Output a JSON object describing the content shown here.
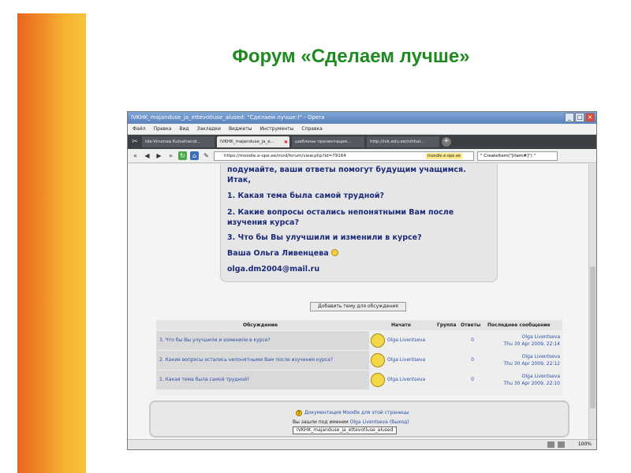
{
  "slide": {
    "title": "Форум «Сделаем лучше»"
  },
  "browser": {
    "window_title": "IVKHK_majanduse_ja_ettevotluse_alused: \"Сделаем лучше:)\" - Opera",
    "menu": [
      "Файл",
      "Правка",
      "Вид",
      "Закладки",
      "Виджеты",
      "Инструменты",
      "Справка"
    ],
    "tabs": [
      {
        "label": "Ida-Virumaa Kutsehanid..."
      },
      {
        "label": "IVKHK_majanduse_ja_e..."
      },
      {
        "label": "шаблоны презентация..."
      },
      {
        "label": "http://ivk.edu.ee/nihhai..."
      }
    ],
    "url": "https://moodle.e-ope.ee/mod/forum/view.php?id=79164",
    "site_badge": "moodle.e-ope.ee",
    "search_value": "\" CreateItem(\"[item#]\") \"",
    "zoom": "100%"
  },
  "message": {
    "line1": "подумайте, ваши ответы помогут будущим учащимся.",
    "line2": "Итак,",
    "q1": "1. Какая тема была самой трудной?",
    "q2a": "2. Какие вопросы остались непонятными Вам после",
    "q2b": "изучения курса?",
    "q3": "3. Что бы Вы улучшили и изменили в курсе?",
    "signature": "Ваша Ольга Ливенцева",
    "email": "olga.dm2004@mail.ru"
  },
  "add_topic_label": "Добавить тему для обсуждения",
  "table": {
    "headers": {
      "discussion": "Обсуждение",
      "started_by": "Начато",
      "group": "Группа",
      "replies": "Ответы",
      "last_post": "Последнее сообщение"
    },
    "rows": [
      {
        "discussion": "3. Что бы Вы улучшили и изменили в курсе?",
        "started_by": "Olga Liventseva",
        "replies": "0",
        "last_author": "Olga Liventseva",
        "last_date": "Thu 30 Apr 2009, 22:14"
      },
      {
        "discussion": "2. Какие вопросы остались непонятными Вам после изучения курса?",
        "started_by": "Olga Liventseva",
        "replies": "0",
        "last_author": "Olga Liventseva",
        "last_date": "Thu 30 Apr 2009, 22:12"
      },
      {
        "discussion": "1. Какая тема была самой трудной?",
        "started_by": "Olga Liventseva",
        "replies": "0",
        "last_author": "Olga Liventseva",
        "last_date": "Thu 30 Apr 2009, 22:10"
      }
    ]
  },
  "footer": {
    "docs_link": "Документация Moodle для этой страницы",
    "login_prefix": "Вы зашли под именем",
    "login_user": "Olga Liventseva",
    "logout": "(Выход)",
    "course_tag": "IVKHK_majanduse_ja_ettevotluse_alused"
  }
}
